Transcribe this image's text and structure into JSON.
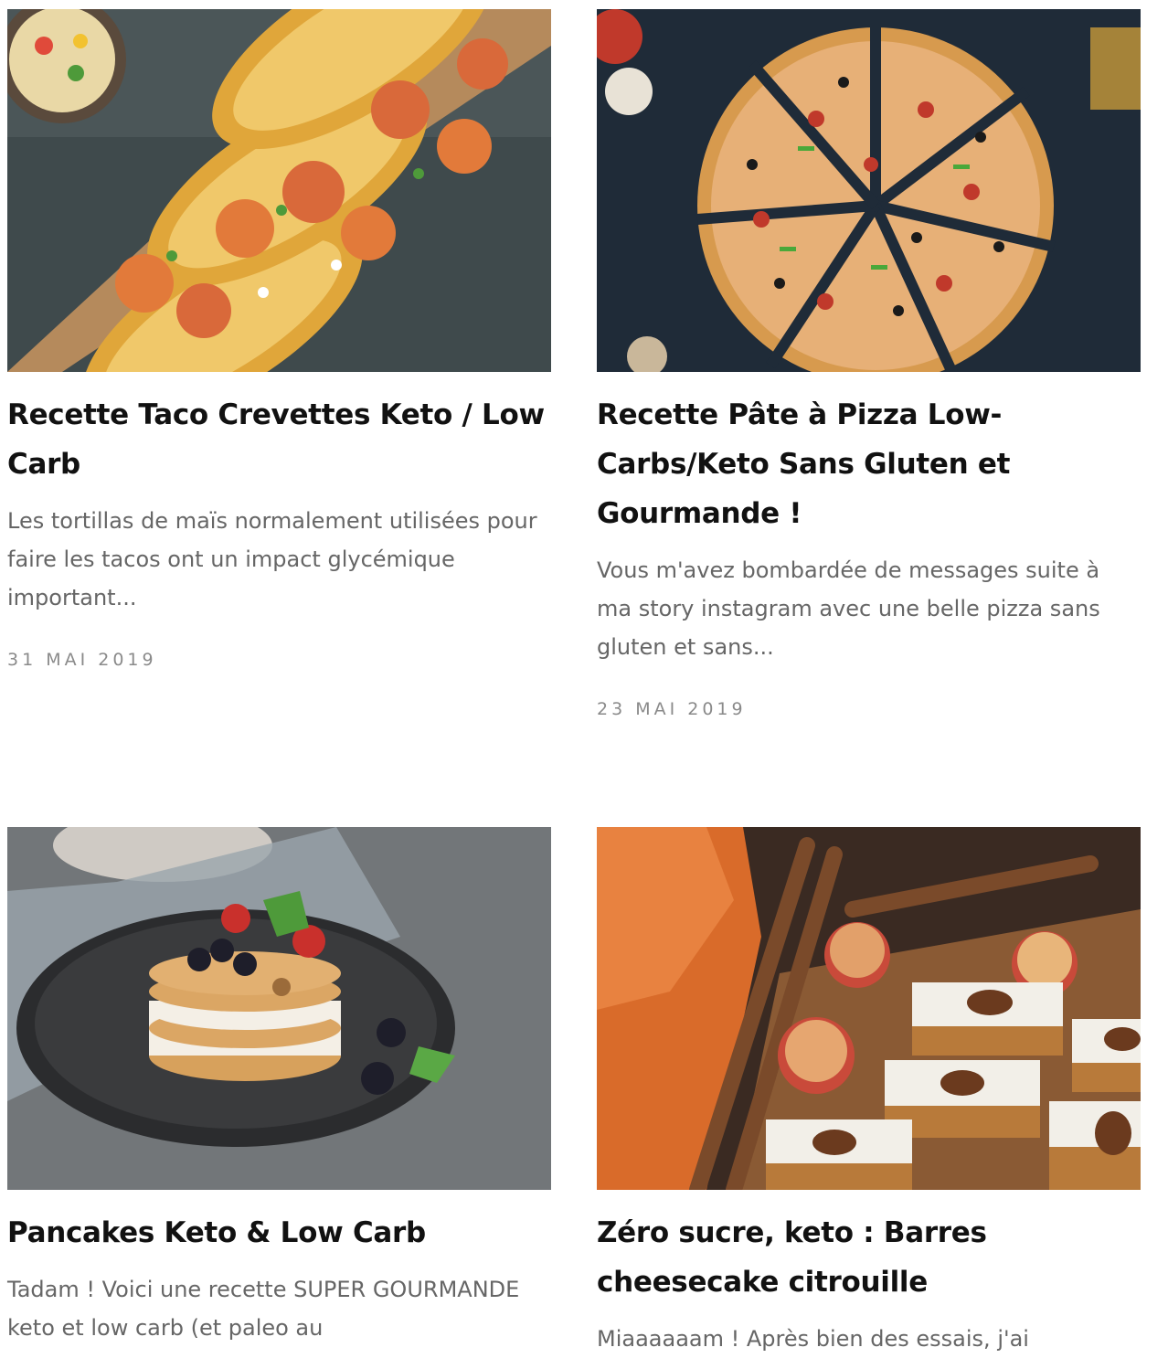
{
  "posts": [
    {
      "title": "Recette Taco Crevettes Keto / Low Carb",
      "excerpt": "Les tortillas de maïs normalement utilisées pour faire les tacos ont un impact glycémique important...",
      "date": "31 MAI 2019",
      "image": "shrimp-tacos-image"
    },
    {
      "title": "Recette Pâte à Pizza Low-Carbs/Keto Sans Gluten et Gourmande !",
      "excerpt": "Vous m'avez bombardée de messages suite à ma story instagram avec une belle pizza sans gluten et sans...",
      "date": "23 MAI 2019",
      "image": "sliced-pizza-image"
    },
    {
      "title": "Pancakes Keto & Low Carb",
      "excerpt": "Tadam ! Voici une recette SUPER GOURMANDE keto et low carb (et paleo au",
      "date": "",
      "image": "pancake-stack-image"
    },
    {
      "title": "Zéro sucre, keto : Barres cheesecake citrouille",
      "excerpt": "Miaaaaaam ! Après bien des essais, j'ai",
      "date": "",
      "image": "pumpkin-cheesecake-bars-image"
    }
  ]
}
